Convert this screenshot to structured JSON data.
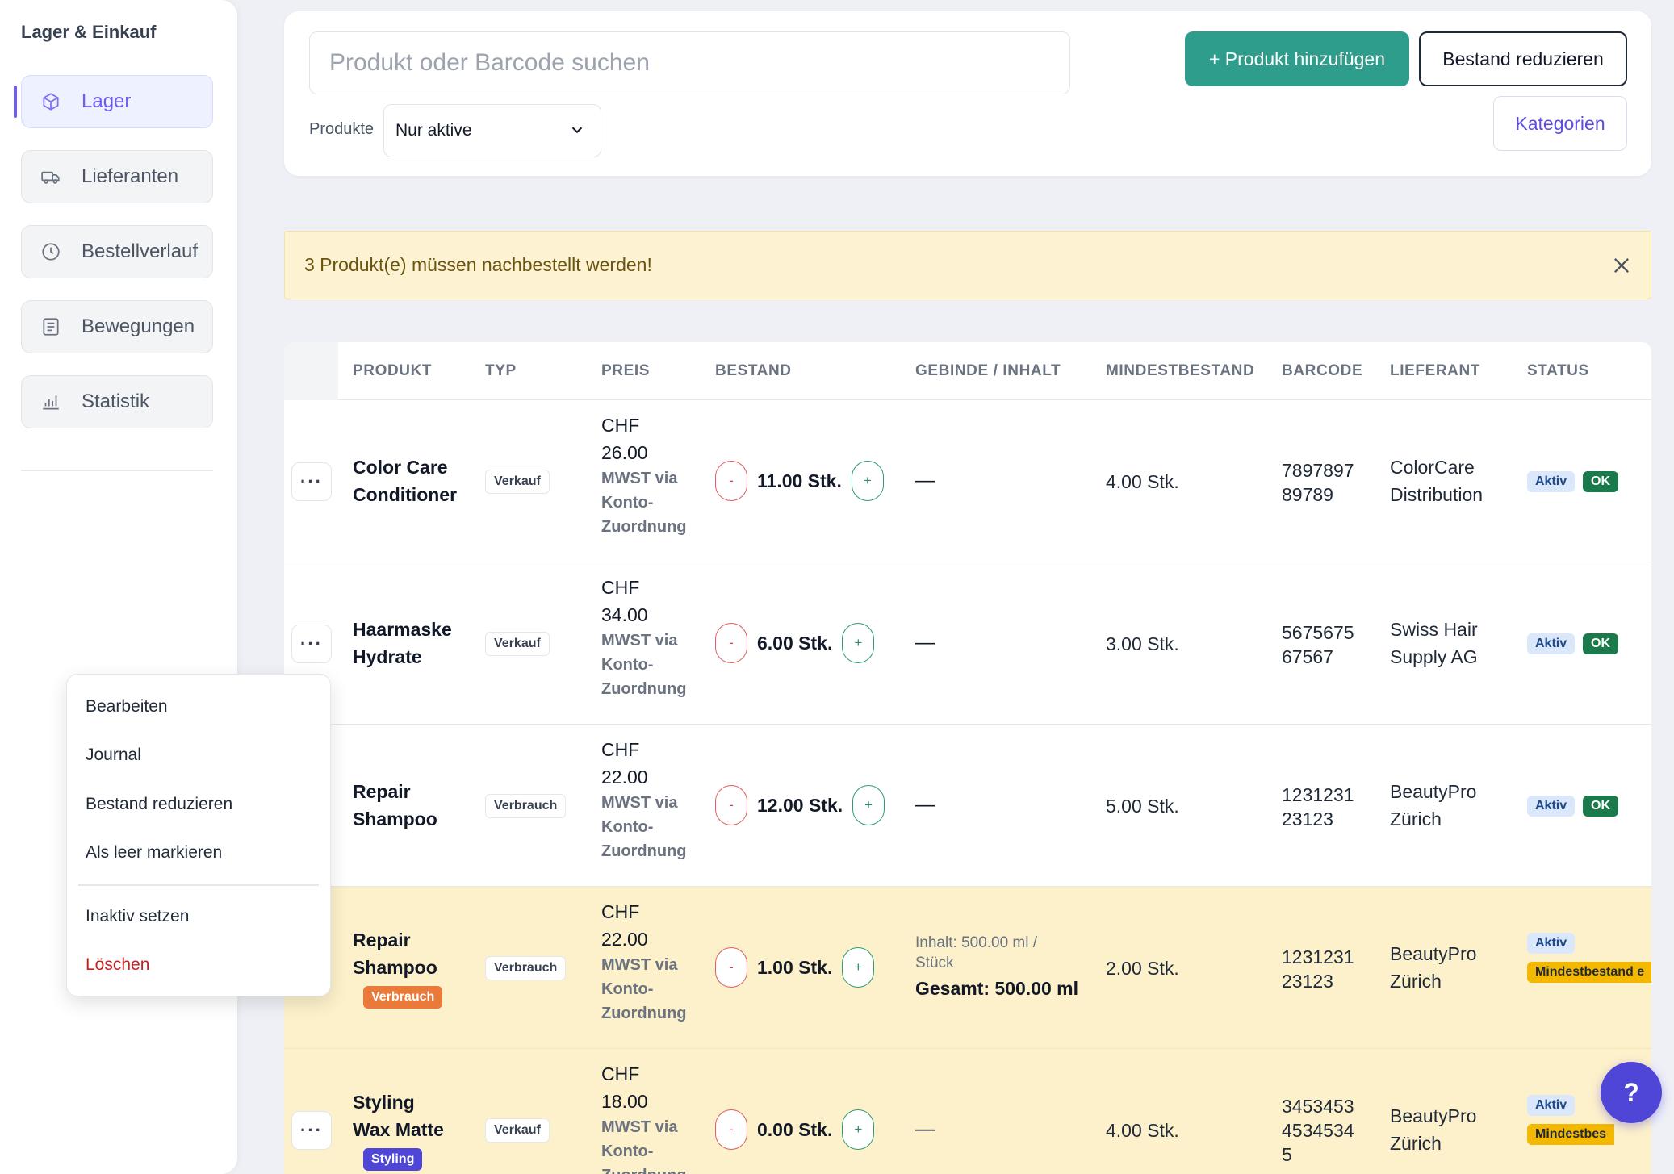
{
  "sidebar": {
    "brand": "Lager & Einkauf",
    "items": [
      {
        "label": "Lager",
        "icon": "box-icon",
        "active": true
      },
      {
        "label": "Lieferanten",
        "icon": "truck-icon"
      },
      {
        "label": "Bestellverlauf",
        "icon": "clock-icon"
      },
      {
        "label": "Bewegungen",
        "icon": "list-icon"
      },
      {
        "label": "Statistik",
        "icon": "bar-chart-icon"
      }
    ]
  },
  "toolbar": {
    "search_placeholder": "Produkt oder Barcode suchen",
    "filter_label": "Produkte",
    "filter_value": "Nur aktive",
    "add_label": "+ Produkt hinzufügen",
    "reduce_label": "Bestand reduzieren",
    "categories_label": "Kategorien"
  },
  "alert": {
    "text": "3 Produkt(e) müssen nachbestellt werden!"
  },
  "table": {
    "headers": {
      "produkt": "PRODUKT",
      "typ": "TYP",
      "preis": "PREIS",
      "bestand": "BESTAND",
      "gebinde": "GEBINDE / INHALT",
      "mindest": "MINDESTBESTAND",
      "barcode": "BARCODE",
      "lieferant": "LIEFERANT",
      "status": "STATUS"
    },
    "rows": [
      {
        "name1": "Color Care",
        "name2": "Conditioner",
        "type": "Verkauf",
        "price1": "CHF",
        "price2": "26.00",
        "mwst1": "MWST via",
        "mwst2": "Konto-",
        "mwst3": "Zuordnung",
        "minus": "-",
        "qty": "11.00 Stk.",
        "plus": "+",
        "gebinde": "—",
        "mindest": "4.00 Stk.",
        "barcode1": "7897897",
        "barcode2": "89789",
        "supplier1": "ColorCare",
        "supplier2": "Distribution",
        "status1": "Aktiv",
        "status2": "OK"
      },
      {
        "name1": "Haarmaske",
        "name2": "Hydrate",
        "type": "Verkauf",
        "price1": "CHF",
        "price2": "34.00",
        "mwst1": "MWST via",
        "mwst2": "Konto-",
        "mwst3": "Zuordnung",
        "minus": "-",
        "qty": "6.00 Stk.",
        "plus": "+",
        "gebinde": "—",
        "mindest": "3.00 Stk.",
        "barcode1": "5675675",
        "barcode2": "67567",
        "supplier1": "Swiss Hair",
        "supplier2": "Supply AG",
        "status1": "Aktiv",
        "status2": "OK"
      },
      {
        "name1": "Repair",
        "name2": "Shampoo",
        "type": "Verbrauch",
        "price1": "CHF",
        "price2": "22.00",
        "mwst1": "MWST via",
        "mwst2": "Konto-",
        "mwst3": "Zuordnung",
        "minus": "-",
        "qty": "12.00 Stk.",
        "plus": "+",
        "gebinde": "—",
        "mindest": "5.00 Stk.",
        "barcode1": "1231231",
        "barcode2": "23123",
        "supplier1": "BeautyPro",
        "supplier2": "Zürich",
        "status1": "Aktiv",
        "status2": "OK"
      },
      {
        "name1": "Repair",
        "name2": "Shampoo",
        "tag": "Verbrauch",
        "tag_color": "#ea7a3a",
        "type": "Verbrauch",
        "price1": "CHF",
        "price2": "22.00",
        "mwst1": "MWST via",
        "mwst2": "Konto-",
        "mwst3": "Zuordnung",
        "minus": "-",
        "qty": "1.00 Stk.",
        "plus": "+",
        "gebinde_info1": "Inhalt: 500.00 ml /",
        "gebinde_info2": "Stück",
        "gebinde_total": "Gesamt: 500.00 ml",
        "mindest": "2.00 Stk.",
        "barcode1": "1231231",
        "barcode2": "23123",
        "supplier1": "BeautyPro",
        "supplier2": "Zürich",
        "status1": "Aktiv",
        "status2": "Mindestbestand e"
      },
      {
        "name1": "Styling",
        "name2": "Wax Matte",
        "tag": "Styling",
        "tag_color": "#4f46d8",
        "type": "Verkauf",
        "price1": "CHF",
        "price2": "18.00",
        "mwst1": "MWST via",
        "mwst2": "Konto-",
        "mwst3": "Zuordnung",
        "minus": "-",
        "qty": "0.00 Stk.",
        "plus": "+",
        "gebinde": "—",
        "mindest": "4.00 Stk.",
        "barcode1": "3453453",
        "barcode2": "4534534",
        "barcode3": "5",
        "supplier1": "BeautyPro",
        "supplier2": "Zürich",
        "status1": "Aktiv",
        "status2": "Mindestbes"
      }
    ]
  },
  "menu": {
    "edit": "Bearbeiten",
    "journal": "Journal",
    "reduce": "Bestand reduzieren",
    "empty": "Als leer markieren",
    "inactive": "Inaktiv setzen",
    "delete": "Löschen"
  },
  "help": {
    "label": "?"
  },
  "colors": {
    "accent": "#6d5df5",
    "primary": "#2e9d8b",
    "warning_row": "#fdf1cb",
    "danger": "#c81e1e"
  }
}
